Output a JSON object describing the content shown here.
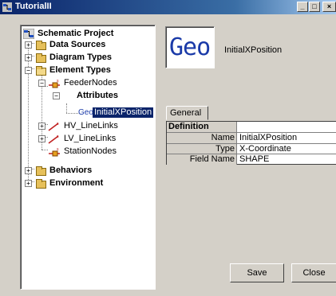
{
  "window": {
    "title": "TutorialII",
    "minimize": "_",
    "maximize": "□",
    "close": "×"
  },
  "tree": {
    "root": "Schematic Project",
    "expand_plus": "+",
    "expand_minus": "−",
    "items": [
      {
        "label": "Data Sources"
      },
      {
        "label": "Diagram Types"
      },
      {
        "label": "Element Types"
      },
      {
        "label": "FeederNodes"
      },
      {
        "label": "Attributes"
      },
      {
        "label": "InitialXPosition",
        "prefix": "Geo"
      },
      {
        "label": "HV_LineLinks"
      },
      {
        "label": "LV_LineLinks"
      },
      {
        "label": "StationNodes"
      },
      {
        "label": "Behaviors"
      },
      {
        "label": "Environment"
      }
    ]
  },
  "detail": {
    "icon_text": "Geo",
    "heading": "InitialXPosition",
    "tab": "General",
    "grid": {
      "section": "Definition",
      "rows": [
        {
          "key": "Name",
          "value": "InitialXPosition"
        },
        {
          "key": "Type",
          "value": "X-Coordinate"
        },
        {
          "key": "Field Name",
          "value": "SHAPE"
        }
      ]
    }
  },
  "buttons": {
    "save": "Save",
    "close": "Close"
  },
  "colors": {
    "titlebar": "#0a246a",
    "selection": "#0a246a",
    "geo_text": "#1a3aa8",
    "folder": "#e6c05a"
  }
}
